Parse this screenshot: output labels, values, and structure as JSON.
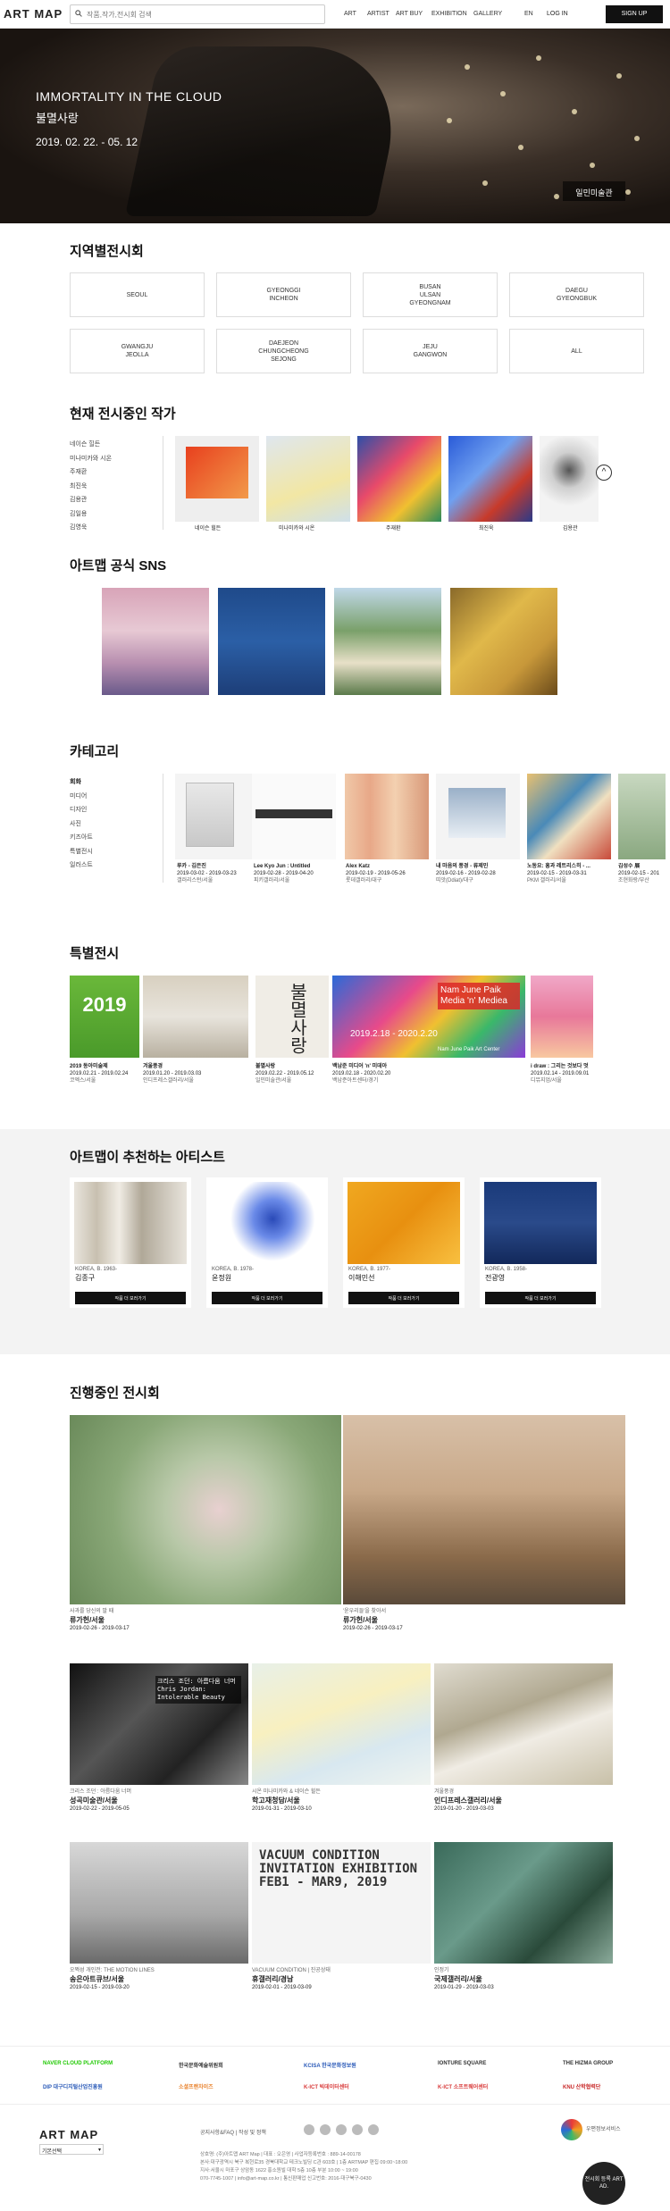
{
  "header": {
    "logo": "ART MAP",
    "search_placeholder": "작품,작가,전시회 검색",
    "nav": [
      "ART",
      "ARTIST",
      "ART BUY",
      "EXHIBITION",
      "GALLERY",
      "EN"
    ],
    "login": "LOG IN",
    "signup": "SIGN UP"
  },
  "hero": {
    "title_en": "IMMORTALITY IN THE CLOUD",
    "title_kr": "불멸사랑",
    "dates": "2019. 02. 22. - 05. 12",
    "venue": "일민미술관"
  },
  "regions": {
    "title": "지역별전시회",
    "buttons": [
      "SEOUL",
      "GYEONGGI\nINCHEON",
      "BUSAN\nULSAN\nGYEONGNAM",
      "DAEGU\nGYEONGBUK",
      "GWANGJU\nJEOLLA",
      "DAEJEON\nCHUNGCHEONG\nSEJONG",
      "JEJU\nGANGWON",
      "ALL"
    ]
  },
  "artists": {
    "title": "현재 전시중인 작가",
    "list": [
      "네이슨 힐든",
      "미나미카와 시온",
      "주재환",
      "최진욱",
      "김용관",
      "김일용",
      "김영욱"
    ],
    "thumbs": [
      "네이슨 힐든",
      "미나미카와 시온",
      "주재환",
      "최진욱",
      "김용관"
    ]
  },
  "sns": {
    "title": "아트맵 공식 SNS"
  },
  "category": {
    "title": "카테고리",
    "list": [
      "회화",
      "미디어",
      "디자인",
      "사진",
      "키즈아트",
      "특별전시",
      "일러스트"
    ],
    "items": [
      {
        "title": "루카 - 김은진",
        "date": "2019-03-02 - 2019-03-23",
        "venue": "갤러리스턴/서울"
      },
      {
        "title": "Lee Kyo Jun : Untitled",
        "date": "2019-02-28 - 2019-04-20",
        "venue": "피키갤러리/서울"
      },
      {
        "title": "Alex Katz",
        "date": "2019-02-19 - 2019-05-26",
        "venue": "롯데갤러리/대구"
      },
      {
        "title": "내 마음의 풍경 - 류제민",
        "date": "2019-02-16 - 2019-02-28",
        "venue": "띠앗(Ddiat)/대구"
      },
      {
        "title": "노동요: 흥과 레트리스히 - ...",
        "date": "2019-02-15 - 2019-03-31",
        "venue": "PKM 갤러리/서울"
      },
      {
        "title": "김성수 展",
        "date": "2019-02-15 - 201",
        "venue": "조현화랑/부산"
      }
    ]
  },
  "special": {
    "title": "특별전시",
    "items": [
      {
        "title": "2019 동아미술제",
        "date": "2019.02.21 - 2019.02.24",
        "venue": "코엑스/서울"
      },
      {
        "title": "겨울풍경",
        "date": "2019.01.20 - 2019.03.03",
        "venue": "인디프레스갤러리/서울"
      },
      {
        "title": "불멸사랑",
        "date": "2019.02.22 - 2019.05.12",
        "venue": "일민미술관/서울"
      },
      {
        "title": "백남준 미디어 'n' 미데아",
        "date": "2019.02.18 - 2020.02.20",
        "venue": "백남준아트센터/경기"
      },
      {
        "title": "i draw : 그리는 것보다 멋",
        "date": "2019.02.14 - 2019.09.01",
        "venue": "디뮤지엄/서울"
      }
    ],
    "banner_text": "Nam June Paik Media 'n' Mediea",
    "banner_dates": "2019.2.18 - 2020.2.20",
    "banner_sub": "Nam June Paik Art Center",
    "card1": "2019",
    "card3": "불멸사랑"
  },
  "recommend": {
    "title": "아트맵이 추천하는 아티스트",
    "artists": [
      {
        "meta": "KOREA, B. 1963-",
        "name": "김종구"
      },
      {
        "meta": "KOREA, B. 1978-",
        "name": "윤정원"
      },
      {
        "meta": "KOREA, B. 1977-",
        "name": "이해민선"
      },
      {
        "meta": "KOREA, B. 1958-",
        "name": "전광영"
      }
    ],
    "button": "작품 더 보러가기"
  },
  "ongoing": {
    "title": "진행중인 전시회",
    "items": [
      {
        "sub": "사과를 당신의 말 때",
        "title": "류가헌/서울",
        "date": "2019-02-26 - 2019-03-17"
      },
      {
        "sub": "'윤우리들'을 찾아서",
        "title": "류가헌/서울",
        "date": "2019-02-26 - 2019-03-17"
      },
      {
        "sub": "크리스 조던 : 아름다움 너머",
        "title": "성곡미술관/서울",
        "date": "2019-02-22 - 2019-05-05"
      },
      {
        "sub": "시온 미나미카와 & 네이슨 힐든",
        "title": "학고재청담/서울",
        "date": "2019-01-31 - 2019-03-10"
      },
      {
        "sub": "겨울풍경",
        "title": "인디프레스갤러리/서울",
        "date": "2019-01-20 - 2019-03-03"
      },
      {
        "sub": "오쩍성 개인전: THE MOTION LINES",
        "title": "송은아트큐브/서울",
        "date": "2019-02-15 - 2019-03-20"
      },
      {
        "sub": "VACUUM CONDITION | 진공상태",
        "title": "휴갤러리/경남",
        "date": "2019-02-01 - 2019-03-09"
      },
      {
        "sub": "인정기",
        "title": "국제갤러리/서울",
        "date": "2019-01-29 - 2019-03-03"
      }
    ],
    "chris_text": "크리스 조던: 아름다움 너머 Chris Jordan: Intolerable Beauty",
    "vacuum_text": "VACUUM CONDITION INVITATION EXHIBITION FEB1 - MAR9, 2019"
  },
  "partners": [
    "NAVER CLOUD PLATFORM",
    "한국문화예술위원회",
    "KCISA 한국문화정보원",
    "IONTURE SQUARE",
    "THE HIZMA GROUP",
    "DIP 대구디지털산업진흥원",
    "소셜프랜차이즈",
    "K-ICT 빅데이터센터",
    "K-ICT 소프트웨어센터",
    "KNU 산학협력단"
  ],
  "footer": {
    "logo": "ART MAP",
    "lang": "기본선택",
    "links": "공지사항&FAQ | 작성 및 정책",
    "company": "상호명: (주)아트맵 ART Map | 대표 : 오은영 | 사업자등록번호 : 889-14-00178",
    "address": "본사:대구광역시 북구 복현로35 경북대학교 테크노빌딩 C관 603호 | 1층 ARTMAP 편집 09:00~18:00",
    "address2": "지사:서울시 마포구 상암동 1622 홍소원빌 대학 5층 10층 부분 10:00 ~ 19:00",
    "contact": "070-7745-1007 | info@art-map.co.kr | 통신판매업 신고번호: 2016-대구북구-0430",
    "badge1": "우편정보서비스",
    "badge2": "전시회 등록 ART AD."
  }
}
